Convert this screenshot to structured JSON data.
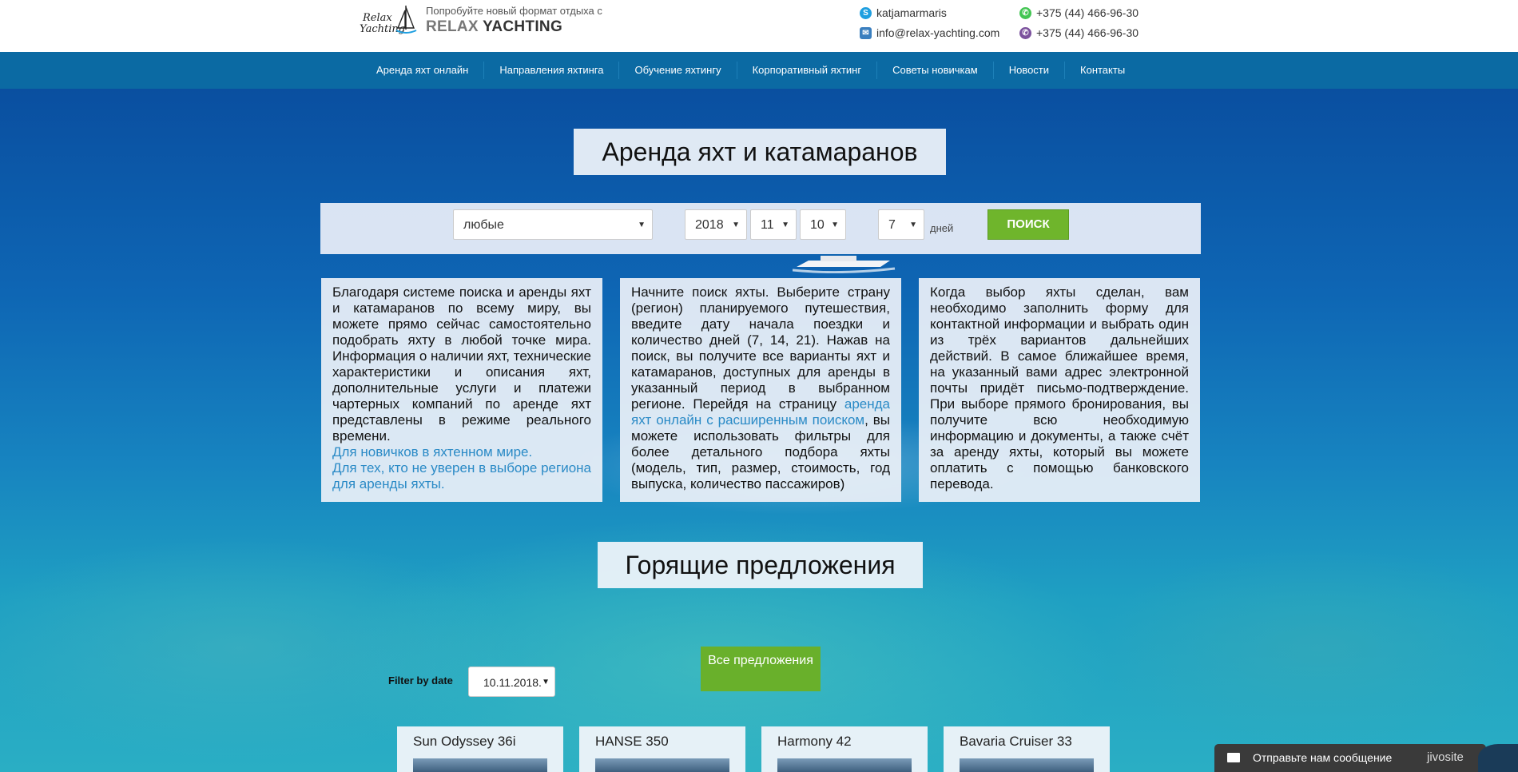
{
  "header": {
    "logo_line1": "Relax",
    "logo_line2": "Yachting",
    "tagline": "Попробуйте новый формат отдыха с",
    "brand_part1": "RELAX",
    "brand_part2": " YACHTING",
    "skype": "katjamarmaris",
    "email": "info@relax-yachting.com",
    "phone_whatsapp": "+375 (44) 466-96-30",
    "phone_viber": "+375 (44) 466-96-30"
  },
  "nav": {
    "items": [
      {
        "label": "Аренда яхт онлайн"
      },
      {
        "label": "Направления яхтинга"
      },
      {
        "label": "Обучение яхтингу"
      },
      {
        "label": "Корпоративный яхтинг"
      },
      {
        "label": "Советы новичкам"
      },
      {
        "label": "Новости"
      },
      {
        "label": "Контакты"
      }
    ]
  },
  "hero": {
    "title": "Аренда яхт и катамаранов"
  },
  "search": {
    "country": "любые",
    "year": "2018",
    "month": "11",
    "day": "10",
    "days": "7",
    "days_label": "дней",
    "button": "ПОИСК"
  },
  "info": {
    "col1_text": "Благодаря системе поиска и аренды яхт и катамаранов по всему миру, вы можете прямо сейчас самостоятельно подобрать яхту в любой точке мира. Информация о наличии яхт, технические характеристики и описания яхт, дополнительные услуги и платежи чартерных компаний по аренде яхт представлены в режиме реального времени.",
    "col1_link1": "Для новичков в яхтенном мире.",
    "col1_link2": "Для тех, кто не уверен в выборе региона для аренды яхты.",
    "col2_text_a": "Начните поиск яхты. Выберите страну (регион) планируемого путешествия, введите дату начала поездки и количество дней (7, 14, 21). Нажав на поиск, вы получите все варианты яхт и катамаранов, доступных для аренды в указанный период в выбранном регионе. Перейдя на страницу ",
    "col2_link": "аренда яхт онлайн с расширенным поиском",
    "col2_text_b": ", вы можете использовать фильтры для более детального подбора яхты (модель, тип, размер, стоимость, год выпуска, количество пассажиров)",
    "col3_text": "Когда выбор яхты сделан, вам необходимо заполнить форму для контактной информации и выбрать один из трёх вариантов дальнейших действий. В самое ближайшее время, на указанный вами адрес электронной почты придёт письмо-подтверждение. При выборе прямого бронирования, вы получите всю необходимую информацию и документы, а также счёт за аренду яхты, который вы можете оплатить с помощью банковского перевода."
  },
  "hot": {
    "title": "Горящие предложения",
    "all_button": "Все предложения",
    "filter_label": "Filter by date",
    "filter_value": "10.11.2018.",
    "cards": [
      {
        "title": "Sun Odyssey 36i"
      },
      {
        "title": "HANSE 350"
      },
      {
        "title": "Harmony 42"
      },
      {
        "title": "Bavaria Cruiser 33"
      }
    ]
  },
  "chat": {
    "label": "Отправьте нам сообщение",
    "brand": "jivosite"
  }
}
